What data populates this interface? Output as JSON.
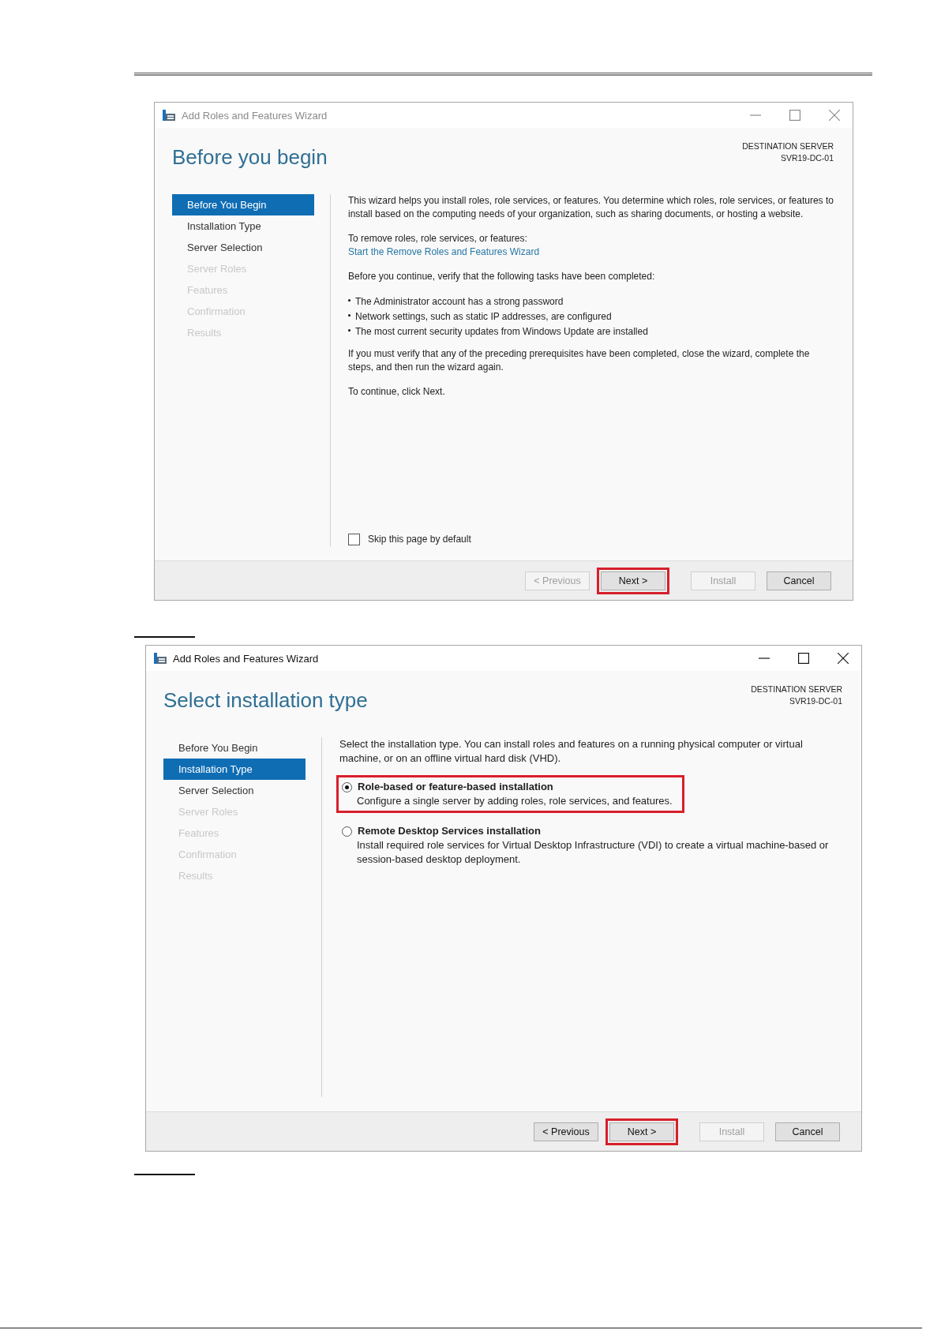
{
  "windows": [
    {
      "active": false,
      "title": "Add Roles and Features Wizard",
      "heading": "Before you begin",
      "destination": {
        "label": "DESTINATION SERVER",
        "server": "SVR19-DC-01"
      },
      "steps": [
        {
          "label": "Before You Begin",
          "selected": true,
          "enabled": true
        },
        {
          "label": "Installation Type",
          "selected": false,
          "enabled": true
        },
        {
          "label": "Server Selection",
          "selected": false,
          "enabled": true
        },
        {
          "label": "Server Roles",
          "selected": false,
          "enabled": false
        },
        {
          "label": "Features",
          "selected": false,
          "enabled": false
        },
        {
          "label": "Confirmation",
          "selected": false,
          "enabled": false
        },
        {
          "label": "Results",
          "selected": false,
          "enabled": false
        }
      ],
      "content": [
        {
          "kind": "paragraph",
          "text": "This wizard helps you install roles, role services, or features. You determine which roles, role services, or features to install based on the computing needs of your organization, such as sharing documents, or hosting a website."
        },
        {
          "kind": "link_group",
          "text": "To remove roles, role services, or features:",
          "link": "Start the Remove Roles and Features Wizard"
        },
        {
          "kind": "paragraph",
          "text": "Before you continue, verify that the following tasks have been completed:"
        },
        {
          "kind": "bullets",
          "items": [
            "The Administrator account has a strong password",
            "Network settings, such as static IP addresses, are configured",
            "The most current security updates from Windows Update are installed"
          ]
        },
        {
          "kind": "paragraph",
          "text": "If you must verify that any of the preceding prerequisites have been completed, close the wizard, complete the steps, and then run the wizard again."
        },
        {
          "kind": "paragraph",
          "text": "To continue, click Next."
        }
      ],
      "checkbox": {
        "label": "Skip this page by default",
        "checked": false
      },
      "buttons": [
        {
          "label": "< Previous",
          "disabled": true,
          "highlighted": false
        },
        {
          "label": "Next >",
          "disabled": false,
          "highlighted": true
        },
        {
          "label": "Install",
          "disabled": true,
          "highlighted": false
        },
        {
          "label": "Cancel",
          "disabled": false,
          "highlighted": false
        }
      ]
    },
    {
      "active": true,
      "title": "Add Roles and Features Wizard",
      "heading": "Select installation type",
      "destination": {
        "label": "DESTINATION SERVER",
        "server": "SVR19-DC-01"
      },
      "steps": [
        {
          "label": "Before You Begin",
          "selected": false,
          "enabled": true
        },
        {
          "label": "Installation Type",
          "selected": true,
          "enabled": true
        },
        {
          "label": "Server Selection",
          "selected": false,
          "enabled": true
        },
        {
          "label": "Server Roles",
          "selected": false,
          "enabled": false
        },
        {
          "label": "Features",
          "selected": false,
          "enabled": false
        },
        {
          "label": "Confirmation",
          "selected": false,
          "enabled": false
        },
        {
          "label": "Results",
          "selected": false,
          "enabled": false
        }
      ],
      "content": [
        {
          "kind": "paragraph",
          "text": "Select the installation type. You can install roles and features on a running physical computer or virtual machine, or on an offline virtual hard disk (VHD)."
        },
        {
          "kind": "radio",
          "label": "Role-based or feature-based installation",
          "description": "Configure a single server by adding roles, role services, and features.",
          "selected": true,
          "highlighted": true
        },
        {
          "kind": "radio",
          "label": "Remote Desktop Services installation",
          "description": "Install required role services for Virtual Desktop Infrastructure (VDI) to create a virtual machine-based or session-based desktop deployment.",
          "selected": false,
          "highlighted": false
        }
      ],
      "buttons": [
        {
          "label": "< Previous",
          "disabled": false,
          "highlighted": false
        },
        {
          "label": "Next >",
          "disabled": false,
          "highlighted": true
        },
        {
          "label": "Install",
          "disabled": true,
          "highlighted": false
        },
        {
          "label": "Cancel",
          "disabled": false,
          "highlighted": false
        }
      ]
    }
  ]
}
